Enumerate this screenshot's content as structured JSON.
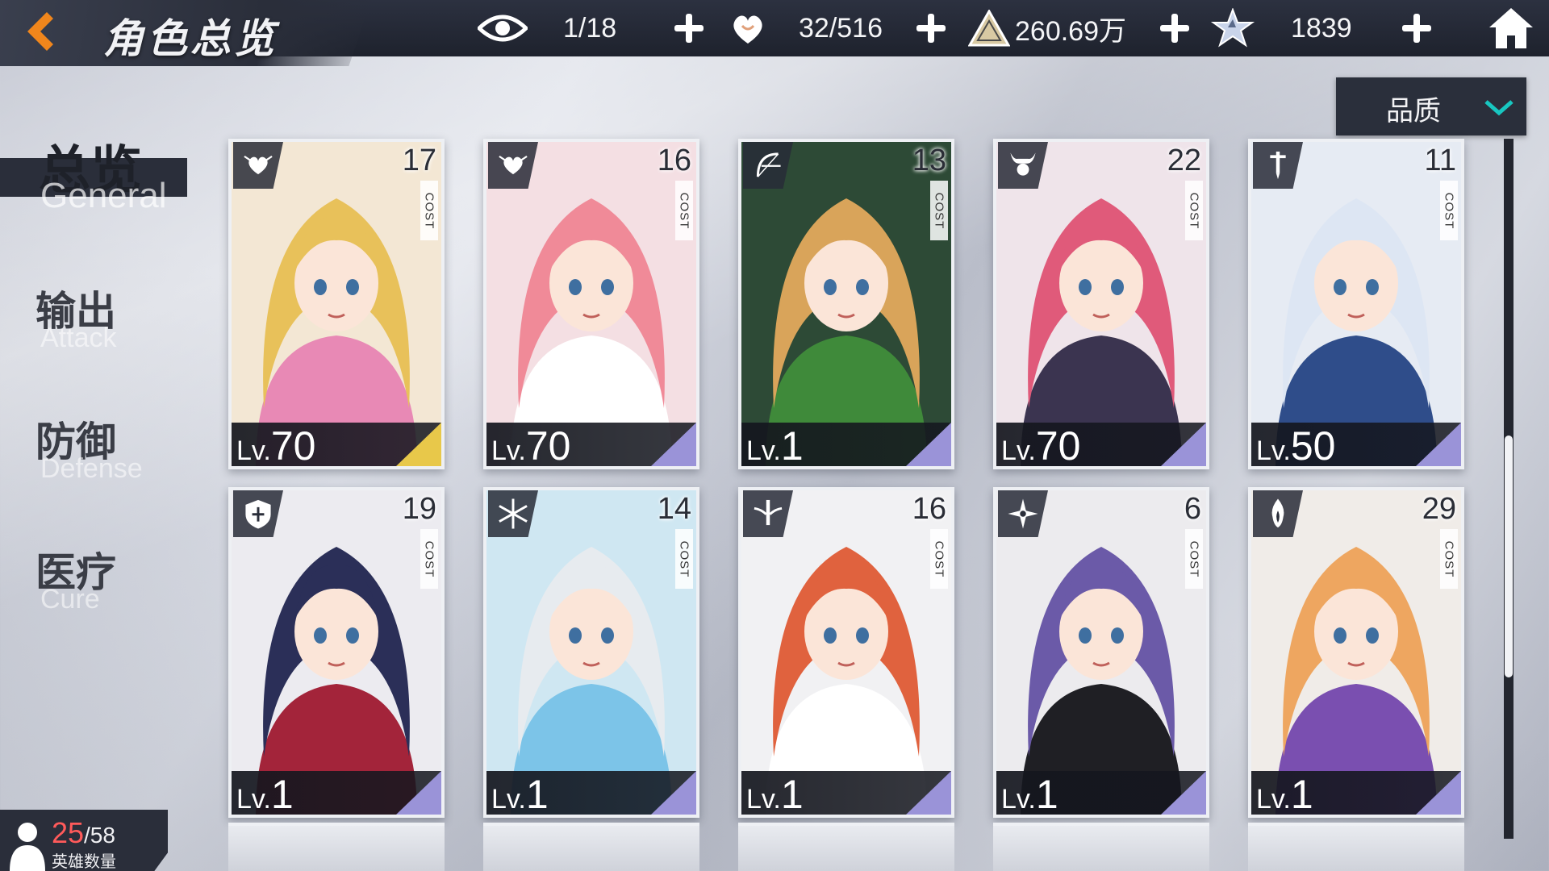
{
  "header": {
    "title": "角色总览",
    "resources": [
      {
        "icon": "eye-icon",
        "value": "1/18"
      },
      {
        "icon": "heart-hand-icon",
        "value": "32/516"
      },
      {
        "icon": "triangle-emblem-icon",
        "value": "260.69万"
      },
      {
        "icon": "star-emblem-icon",
        "value": "1839"
      }
    ]
  },
  "sort": {
    "label": "品质"
  },
  "nav": [
    {
      "cn": "总览",
      "en": "General",
      "active": true
    },
    {
      "cn": "输出",
      "en": "Attack",
      "active": false
    },
    {
      "cn": "防御",
      "en": "Defense",
      "active": false
    },
    {
      "cn": "医疗",
      "en": "Cure",
      "active": false
    }
  ],
  "cost_label": "COST",
  "level_prefix": "Lv.",
  "cards": [
    {
      "cost": "17",
      "level": "70",
      "class_icon": "heart-wing-icon",
      "hair": "#e8c15a",
      "outfit": "#e889b5",
      "bg": "#f3e7d4",
      "accent": "#e8c84a"
    },
    {
      "cost": "16",
      "level": "70",
      "class_icon": "heart-wing-icon",
      "hair": "#f08a98",
      "outfit": "#ffffff",
      "bg": "#f4dfe3",
      "accent": "#9a93d8"
    },
    {
      "cost": "13",
      "level": "1",
      "class_icon": "bow-icon",
      "hair": "#d9a45a",
      "outfit": "#3f8a3a",
      "bg": "#2d4a36",
      "accent": "#9a93d8"
    },
    {
      "cost": "22",
      "level": "70",
      "class_icon": "horned-mask-icon",
      "hair": "#e05a7a",
      "outfit": "#3b3450",
      "bg": "#efe4ea",
      "accent": "#9a93d8"
    },
    {
      "cost": "11",
      "level": "50",
      "class_icon": "sword-icon",
      "hair": "#dde6f3",
      "outfit": "#2f4d8a",
      "bg": "#e6ebf3",
      "accent": "#9a93d8"
    },
    {
      "cost": "19",
      "level": "1",
      "class_icon": "shield-icon",
      "hair": "#2b2f58",
      "outfit": "#a3243a",
      "bg": "#ecebf0",
      "accent": "#9a93d8"
    },
    {
      "cost": "14",
      "level": "1",
      "class_icon": "snowflake-icon",
      "hair": "#e7ebef",
      "outfit": "#7cc4e8",
      "bg": "#cfe7f2",
      "accent": "#9a93d8"
    },
    {
      "cost": "16",
      "level": "1",
      "class_icon": "winged-sword-icon",
      "hair": "#e0623e",
      "outfit": "#ffffff",
      "bg": "#f1f1f3",
      "accent": "#9a93d8"
    },
    {
      "cost": "6",
      "level": "1",
      "class_icon": "shuriken-icon",
      "hair": "#6b5aa8",
      "outfit": "#1f1f24",
      "bg": "#ecebee",
      "accent": "#9a93d8"
    },
    {
      "cost": "29",
      "level": "1",
      "class_icon": "flame-icon",
      "hair": "#eea660",
      "outfit": "#7a4fb0",
      "bg": "#f0ece8",
      "accent": "#9a93d8"
    }
  ],
  "hero_count": {
    "current": "25",
    "max": "/58",
    "label": "英雄数量"
  }
}
